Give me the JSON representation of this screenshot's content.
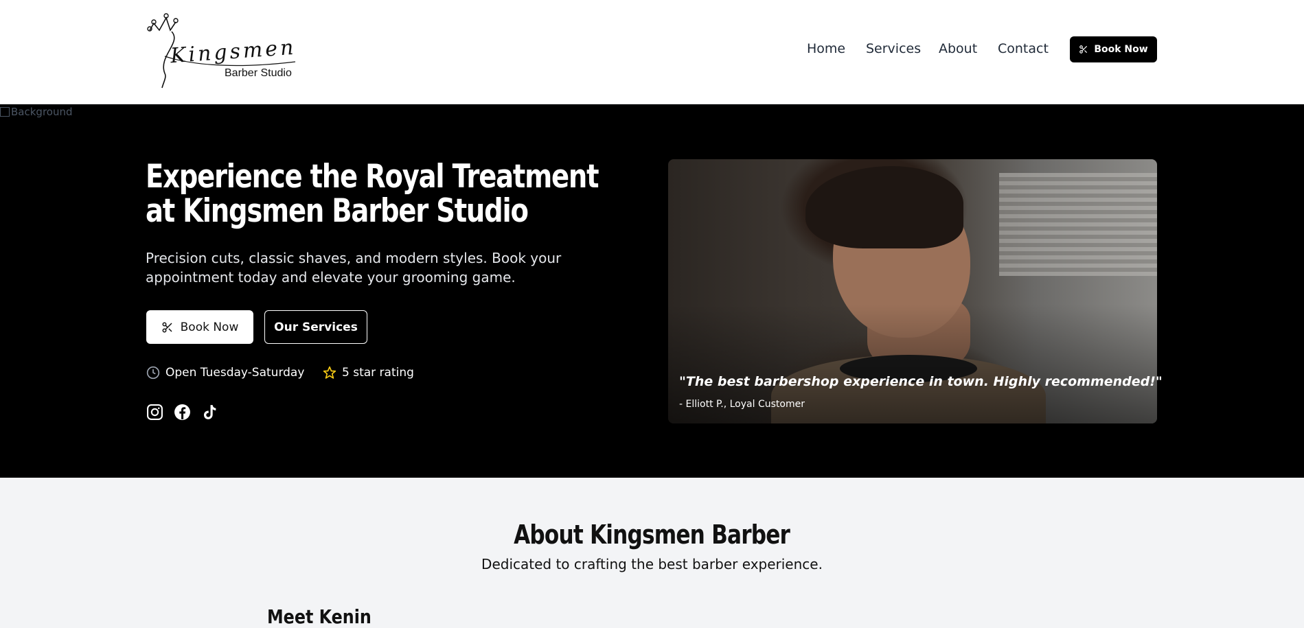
{
  "header": {
    "logo_script": "Kingsmen",
    "logo_sub": "Barber Studio",
    "nav": [
      "Home",
      "Services",
      "About",
      "Contact"
    ],
    "book_label": "Book Now"
  },
  "hero": {
    "broken_image_alt": "Background",
    "title": "Experience the Royal Treatment at Kingsmen Barber Studio",
    "subtitle": "Precision cuts, classic shaves, and modern styles. Book your appointment today and elevate your grooming game.",
    "book_label": "Book Now",
    "services_label": "Our Services",
    "hours": "Open Tuesday-Saturday",
    "rating": "5 star rating",
    "quote": "\"The best barbershop experience in town. Highly recommended!\"",
    "quote_author": "- Elliott P., Loyal Customer",
    "star_color": "#facc15"
  },
  "about": {
    "title": "About Kingsmen Barber",
    "subtitle": "Dedicated to crafting the best barber experience.",
    "meet": "Meet Kenin"
  },
  "icons": [
    "crown-icon",
    "scissors-icon",
    "clock-icon",
    "star-icon",
    "instagram-icon",
    "facebook-icon",
    "tiktok-icon"
  ]
}
